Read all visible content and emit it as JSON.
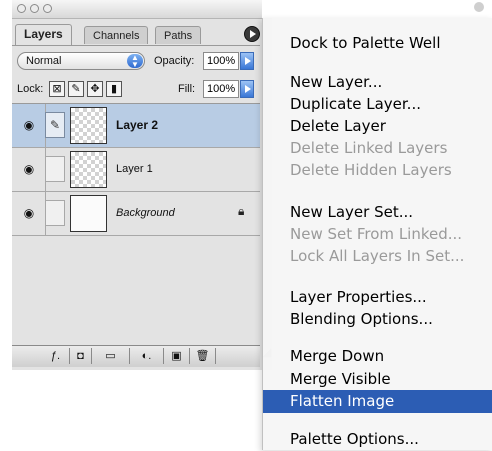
{
  "palette": {
    "tabs": [
      {
        "label": "Layers",
        "active": true
      },
      {
        "label": "Channels",
        "active": false
      },
      {
        "label": "Paths",
        "active": false
      }
    ],
    "blend_mode": "Normal",
    "opacity_label": "Opacity:",
    "opacity_value": "100%",
    "lock_label": "Lock:",
    "fill_label": "Fill:",
    "fill_value": "100%",
    "layers": [
      {
        "name": "Layer 2",
        "selected": true,
        "thumb": "transparent"
      },
      {
        "name": "Layer 1",
        "selected": false,
        "thumb": "transparent"
      },
      {
        "name": "Background",
        "selected": false,
        "thumb": "white",
        "locked": true
      }
    ],
    "colors": {
      "selected_row": "#b8cce4",
      "panel_bg": "#e3e3e3"
    }
  },
  "menu": {
    "items": [
      {
        "label": "Dock to Palette Well",
        "enabled": true
      },
      {
        "label": "New Layer...",
        "enabled": true
      },
      {
        "label": "Duplicate Layer...",
        "enabled": true
      },
      {
        "label": "Delete Layer",
        "enabled": true
      },
      {
        "label": "Delete Linked Layers",
        "enabled": false
      },
      {
        "label": "Delete Hidden Layers",
        "enabled": false
      },
      {
        "label": "New Layer Set...",
        "enabled": true
      },
      {
        "label": "New Set From Linked...",
        "enabled": false
      },
      {
        "label": "Lock All Layers In Set...",
        "enabled": false
      },
      {
        "label": "Layer Properties...",
        "enabled": true
      },
      {
        "label": "Blending Options...",
        "enabled": true
      },
      {
        "label": "Merge Down",
        "enabled": true
      },
      {
        "label": "Merge Visible",
        "enabled": true
      },
      {
        "label": "Flatten Image",
        "enabled": true,
        "highlighted": true
      },
      {
        "label": "Palette Options...",
        "enabled": true
      }
    ],
    "highlight_color": "#2c5db4"
  }
}
